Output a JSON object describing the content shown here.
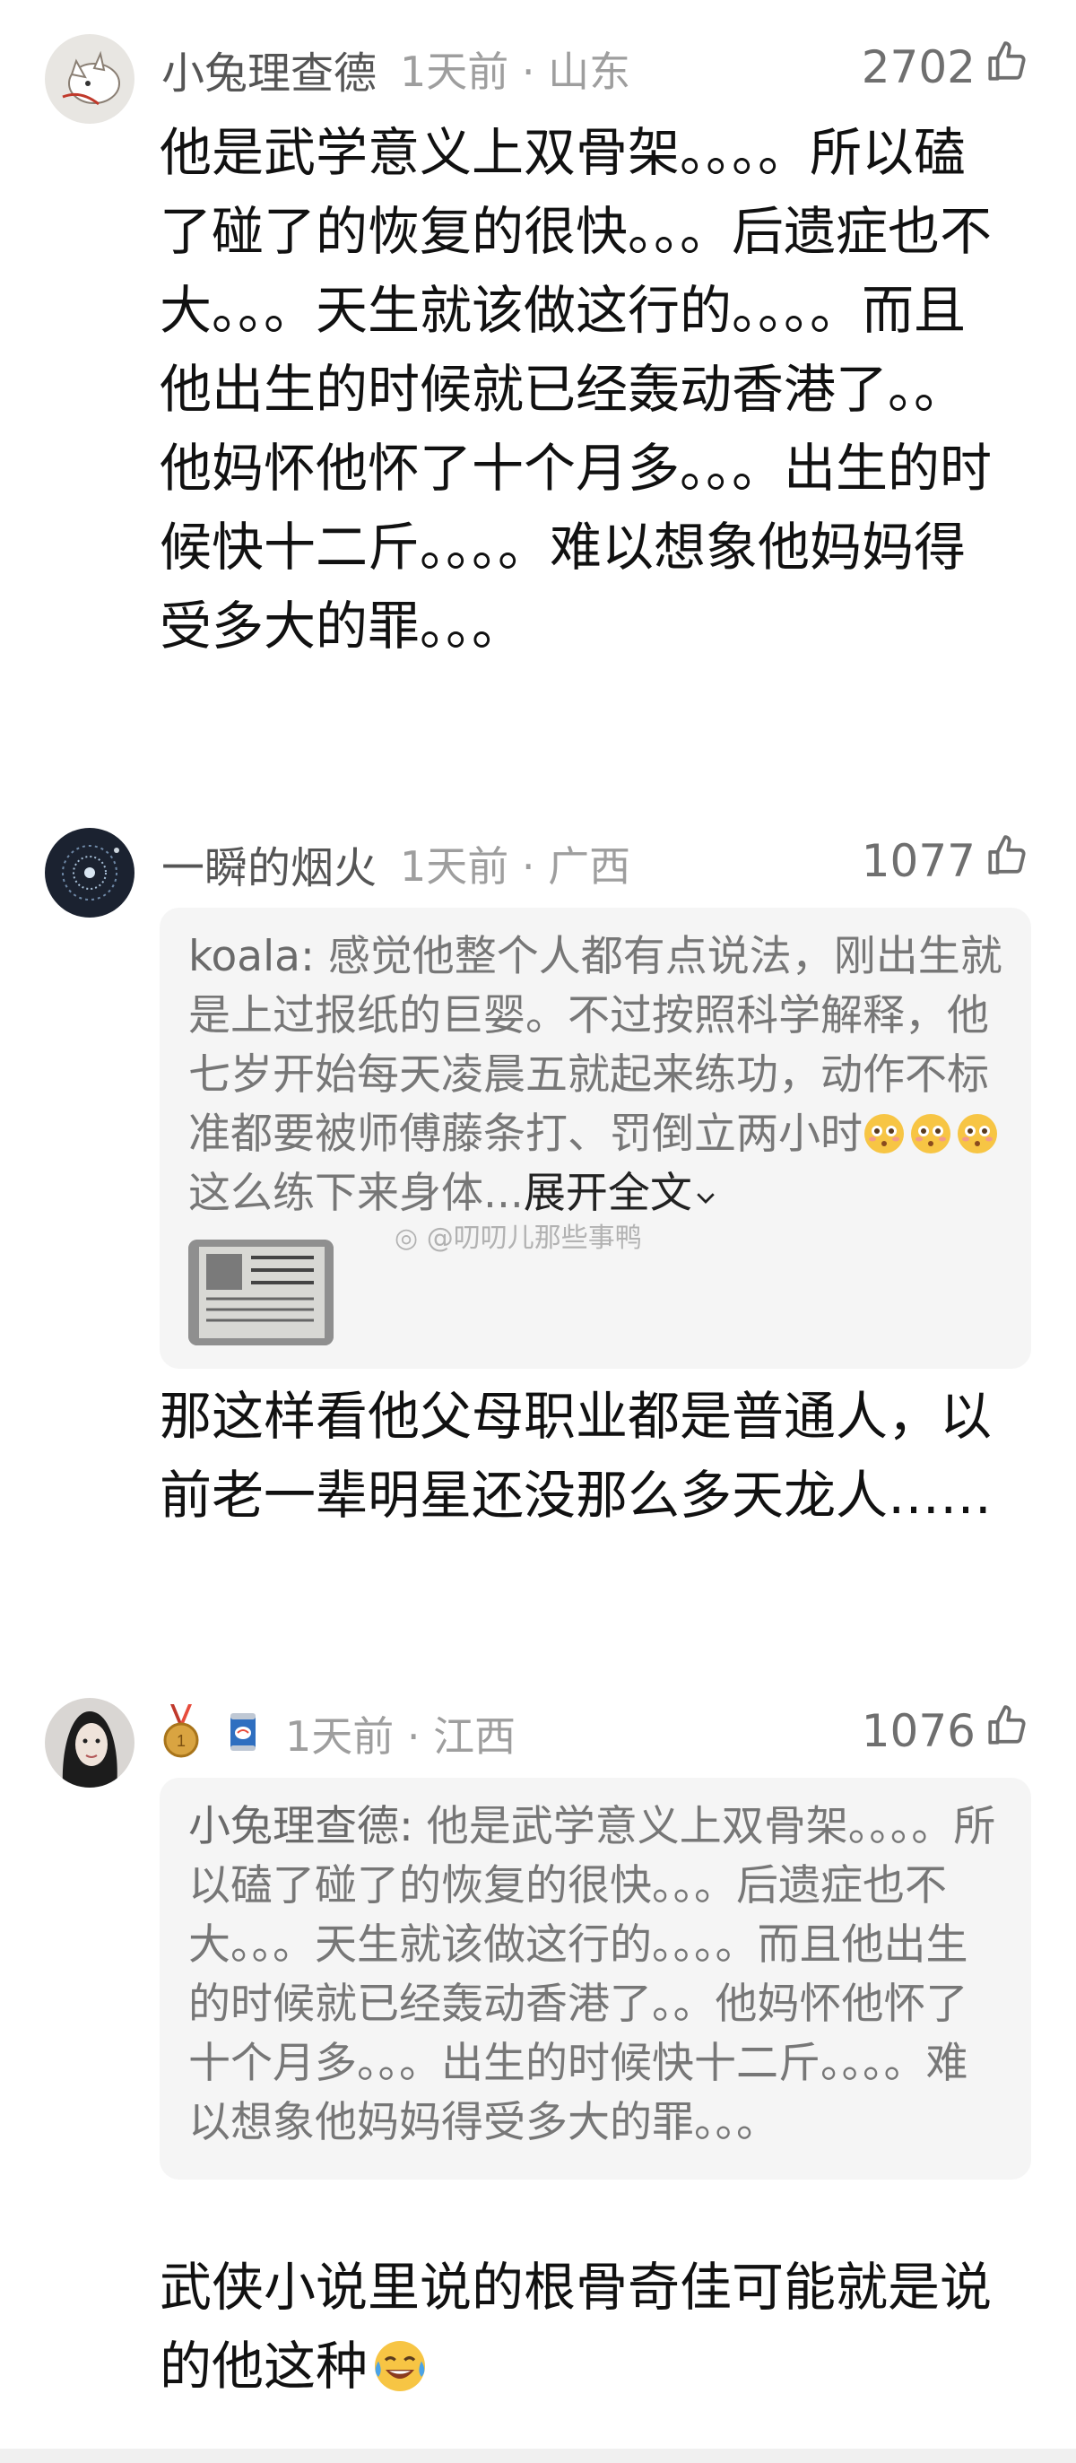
{
  "comments": [
    {
      "username": "小兔理查德",
      "time_location": "1天前 · 山东",
      "likes": "2702",
      "text": "他是武学意义上双骨架。。。。所以磕了碰了的恢复的很快。。。后遗症也不大。。。天生就该做这行的。。。。而且他出生的时候就已经轰动香港了。。他妈怀他怀了十个月多。。。出生的时候快十二斤。。。。难以想象他妈妈得受多大的罪。。。"
    },
    {
      "username": "一瞬的烟火",
      "time_location": "1天前 · 广西",
      "likes": "1077",
      "quote": {
        "user": "koala:",
        "text_before_emoji": " 感觉他整个人都有点说法，刚出生就是上过报纸的巨婴。不过按照科学解释，他七岁开始每天凌晨五就起来练功，动作不标准都要被师傅藤条打、罚倒立两小时",
        "text_after_emoji": "这么练下来身体...",
        "expand_label": "展开全文"
      },
      "text": "那这样看他父母职业都是普通人，以前老一辈明星还没那么多天龙人……"
    },
    {
      "username": "",
      "time_location": "1天前 · 江西",
      "likes": "1076",
      "quote": {
        "user": "小兔理查德:",
        "text": " 他是武学意义上双骨架。。。。所以磕了碰了的恢复的很快。。。后遗症也不大。。。天生就该做这行的。。。。而且他出生的时候就已经轰动香港了。。他妈怀他怀了十个月多。。。出生的时候快十二斤。。。。难以想象他妈妈得受多大的罪。。。"
      },
      "text": "武侠小说里说的根骨奇佳可能就是说的他这种"
    }
  ],
  "watermark": "@叨叨儿那些事鸭",
  "icons": {
    "like": "thumbs-up-icon",
    "emoji_flushed": "flushed-face-icon",
    "emoji_laugh": "tears-of-joy-icon",
    "medal": "medal-icon",
    "can": "soda-can-icon",
    "expand": "chevron-down-icon"
  },
  "colors": {
    "username": "#555555",
    "meta": "#9e9e9e",
    "quote_bg": "#f5f5f5",
    "quote_text": "#777777"
  }
}
